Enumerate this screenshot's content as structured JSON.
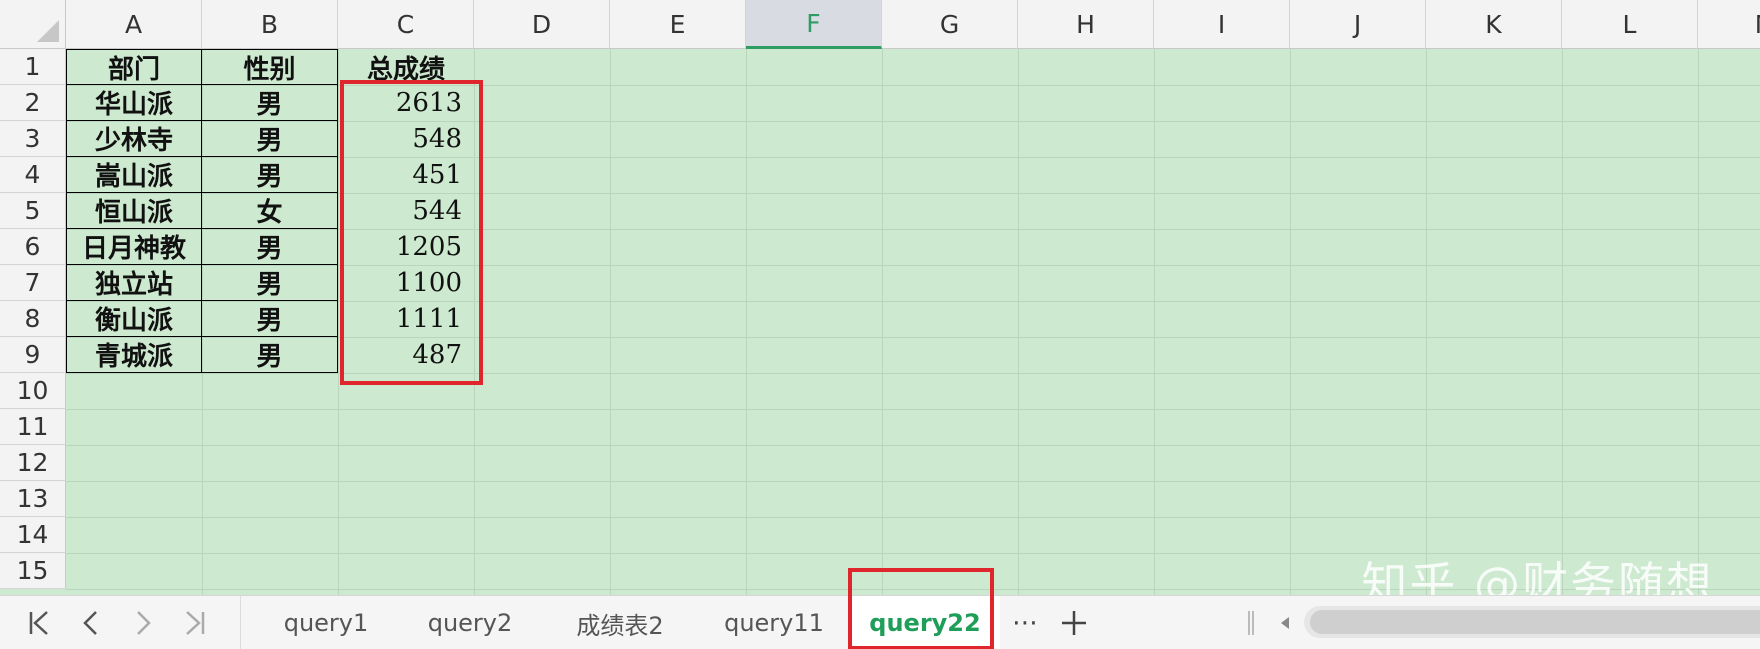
{
  "columns": [
    "A",
    "B",
    "C",
    "D",
    "E",
    "F",
    "G",
    "H",
    "I",
    "J",
    "K",
    "L",
    "M"
  ],
  "active_column": "F",
  "rows": [
    "1",
    "2",
    "3",
    "4",
    "5",
    "6",
    "7",
    "8",
    "9",
    "10",
    "11",
    "12",
    "13",
    "14",
    "15"
  ],
  "table": {
    "headers": [
      "部门",
      "性别",
      "总成绩"
    ],
    "records": [
      [
        "华山派",
        "男",
        "2613"
      ],
      [
        "少林寺",
        "男",
        "548"
      ],
      [
        "嵩山派",
        "男",
        "451"
      ],
      [
        "恒山派",
        "女",
        "544"
      ],
      [
        "日月神教",
        "男",
        "1205"
      ],
      [
        "独立站",
        "男",
        "1100"
      ],
      [
        "衡山派",
        "男",
        "1111"
      ],
      [
        "青城派",
        "男",
        "487"
      ]
    ]
  },
  "highlight_color": "#e0262d",
  "sheet_background": "#cde9cf",
  "sheet_tabs": {
    "tabs": [
      "query1",
      "query2",
      "成绩表2",
      "query11",
      "query22"
    ],
    "active": "query22",
    "more_label": "⋯"
  },
  "watermark": "知乎 @财务随想",
  "icons": {
    "first_sheet": "first-sheet-icon",
    "prev_sheet": "prev-sheet-icon",
    "next_sheet": "next-sheet-icon",
    "last_sheet": "last-sheet-icon",
    "add_sheet": "plus-icon",
    "scroll_left": "scroll-left-icon"
  }
}
